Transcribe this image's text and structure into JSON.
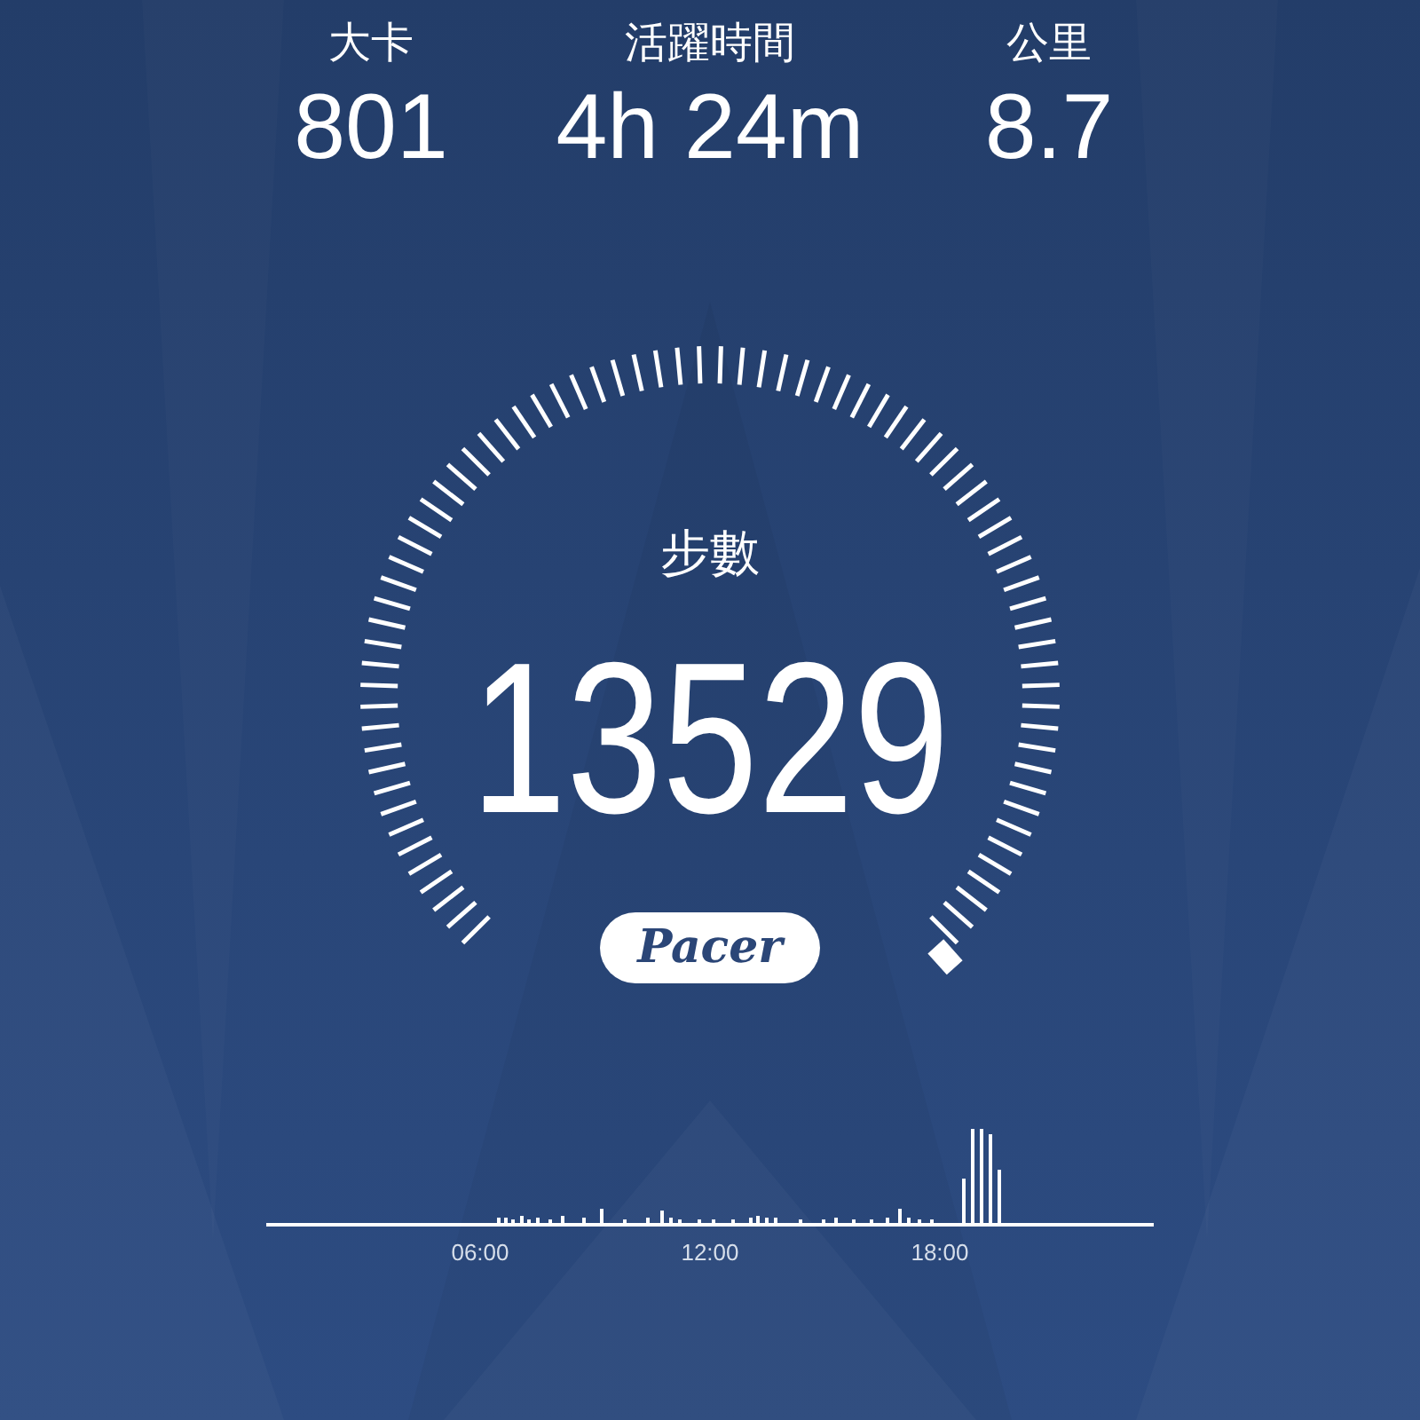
{
  "stats": [
    {
      "label": "大卡",
      "value": "801"
    },
    {
      "label": "活躍時間",
      "value": "4h 24m"
    },
    {
      "label": "公里",
      "value": "8.7"
    }
  ],
  "gauge": {
    "label": "步數",
    "value": "13529"
  },
  "brand": "Pacer",
  "timeline": {
    "labels": [
      "06:00",
      "12:00",
      "18:00"
    ]
  }
}
